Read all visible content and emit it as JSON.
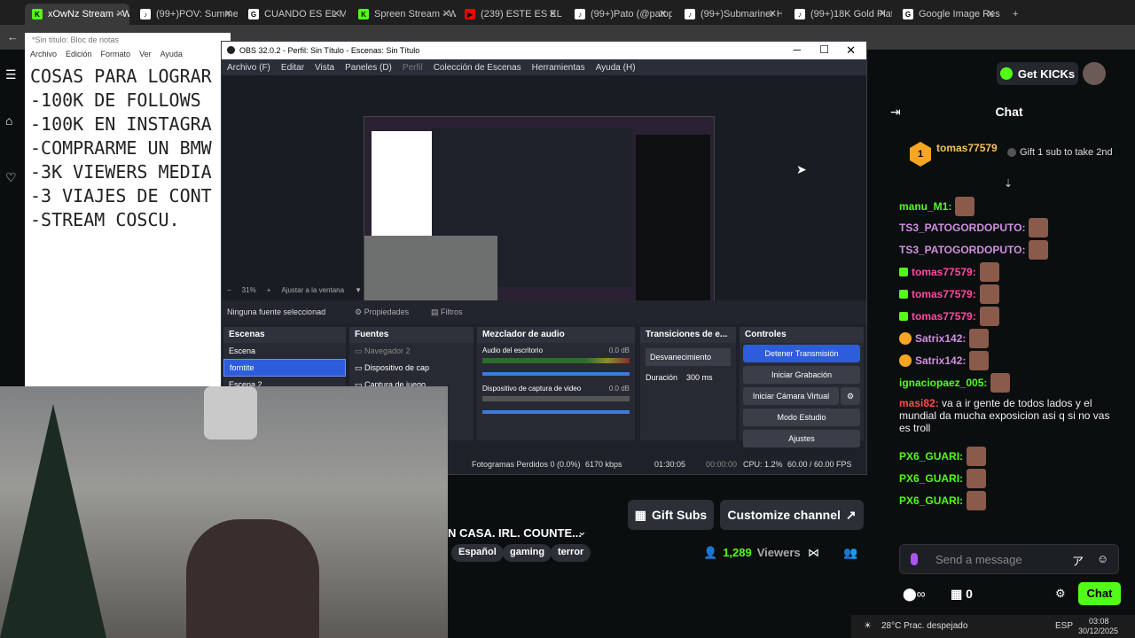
{
  "browser": {
    "tabs": [
      {
        "label": "xOwNz Stream - Wa",
        "fav": "K",
        "color": "#53fc18",
        "active": true
      },
      {
        "label": "(99+)POV: Summer a",
        "fav": "♪",
        "color": "#ffffff"
      },
      {
        "label": "CUANDO ES EL MUN",
        "fav": "G",
        "color": "#ffffff"
      },
      {
        "label": "Spreen Stream - Wa",
        "fav": "K",
        "color": "#53fc18"
      },
      {
        "label": "(239) ESTE ES EL UN",
        "fav": "▶",
        "color": "#ff0000"
      },
      {
        "label": "(99+)Pato (@patope",
        "fav": "♪",
        "color": "#ffffff"
      },
      {
        "label": "(99+)Submariner Hu",
        "fav": "♪",
        "color": "#ffffff"
      },
      {
        "label": "(99+)18K Gold Plate",
        "fav": "♪",
        "color": "#ffffff"
      },
      {
        "label": "Google Image Result",
        "fav": "G",
        "color": "#ffffff"
      }
    ]
  },
  "notepad": {
    "title": "*Sin título: Bloc de notas",
    "menu": [
      "Archivo",
      "Edición",
      "Formato",
      "Ver",
      "Ayuda"
    ],
    "lines": "COSAS PARA LOGRAR\n-100K DE FOLLOWS\n-100K EN INSTAGRA\n-COMPRARME UN BMW\n-3K VIEWERS MEDIA\n-3 VIAJES DE CONT\n-STREAM COSCU."
  },
  "obs": {
    "title": "OBS 32.0.2 - Perfil: Sin Título - Escenas: Sin Título",
    "menu": [
      "Archivo (F)",
      "Editar",
      "Vista",
      "Paneles (D)",
      "Perfil",
      "Colección de Escenas",
      "Herramientas",
      "Ayuda (H)"
    ],
    "zoom": "31%",
    "fit": "Ajustar a la ventana",
    "no_source": "Ninguna fuente seleccionad",
    "props": "Propiedades",
    "filters": "Filtros",
    "scenes_hdr": "Escenas",
    "scenes": [
      "Escena",
      "forntite",
      "Escena 2"
    ],
    "sources_hdr": "Fuentes",
    "sources": [
      "Navegador 2",
      "Dispositivo de cap",
      "Captura de juego"
    ],
    "mixer_hdr": "Mezclador de audio",
    "mix1": "Audio del escritorio",
    "mix1db": "0.0 dB",
    "mix2": "Dispositivo de captura de video",
    "mix2db": "0.0 dB",
    "trans_hdr": "Transiciones de e...",
    "trans": "Desvanecimiento",
    "dur_label": "Duración",
    "dur": "300 ms",
    "ctrl_hdr": "Controles",
    "btns": [
      "Detener Transmisión",
      "Iniciar Grabación",
      "Iniciar Cámara Virtual",
      "Modo Estudio",
      "Ajustes"
    ],
    "status": {
      "frames": "Fotogramas Perdidos 0 (0.0%)",
      "kbps": "6170 kbps",
      "live": "01:30:05",
      "rec": "00:00:00",
      "cpu": "CPU: 1.2%",
      "fps": "60.00 / 60.00 FPS"
    }
  },
  "kick": {
    "getkicks": "Get KICKs",
    "chat_title": "Chat",
    "pinned_user": "tomas77579",
    "pinned_badge": "1",
    "gift_promo": "Gift 1 sub to take 2nd",
    "messages": [
      {
        "user": "manu_M1:",
        "color": "#53fc18",
        "emote": true
      },
      {
        "user": "TS3_PATOGORDOPUTO:",
        "color": "#d18ee2",
        "emote": true
      },
      {
        "user": "TS3_PATOGORDOPUTO:",
        "color": "#d18ee2",
        "emote": true
      },
      {
        "user": "tomas77579:",
        "color": "#ff4aa0",
        "emote": true,
        "badge": "g"
      },
      {
        "user": "tomas77579:",
        "color": "#ff4aa0",
        "emote": true,
        "badge": "g"
      },
      {
        "user": "tomas77579:",
        "color": "#ff4aa0",
        "emote": true,
        "badge": "g"
      },
      {
        "user": "Satrix142:",
        "color": "#d18ee2",
        "emote": true,
        "badge": "o"
      },
      {
        "user": "Satrix142:",
        "color": "#d18ee2",
        "emote": true,
        "badge": "o"
      },
      {
        "user": "ignaciopaez_005:",
        "color": "#53fc18",
        "emote": true
      },
      {
        "user": "masi82:",
        "color": "#ff4a4a",
        "text": "va a ir gente de todos lados y el mundial da mucha exposicion asi q si no vas es troll"
      },
      {
        "user": "PX6_GUARI:",
        "color": "#53fc18",
        "emote": true
      },
      {
        "user": "PX6_GUARI:",
        "color": "#53fc18",
        "emote": true
      },
      {
        "user": "PX6_GUARI:",
        "color": "#53fc18",
        "emote": true
      }
    ],
    "send_placeholder": "Send a message",
    "points": "0",
    "chat_btn": "Chat",
    "stream_title": "N CASA. IRL. COUNTE...",
    "tags": [
      "Español",
      "gaming",
      "terror"
    ],
    "viewers": "1,289",
    "viewers_label": "Viewers",
    "gift_subs": "Gift Subs",
    "customize": "Customize channel"
  },
  "taskbar": {
    "weather": "28°C Prac. despejado",
    "lang": "ESP",
    "time": "03:08",
    "date": "30/12/2025"
  }
}
